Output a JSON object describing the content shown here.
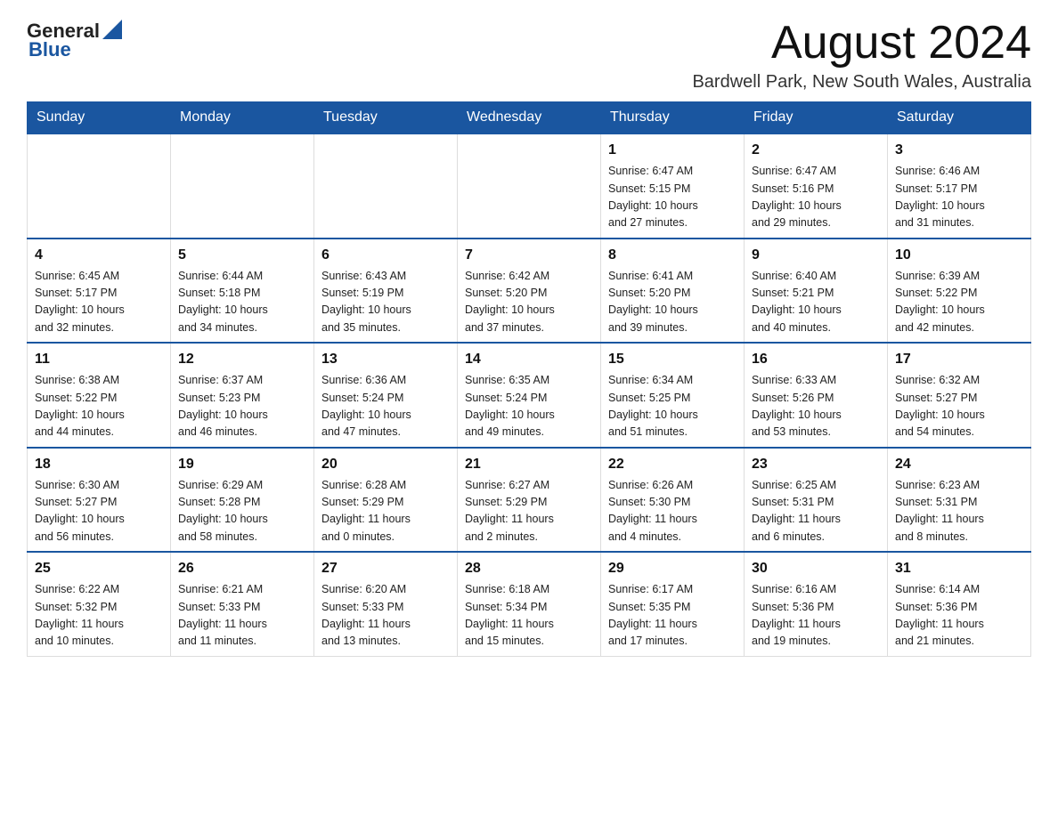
{
  "header": {
    "logo_general": "General",
    "logo_blue": "Blue",
    "month_title": "August 2024",
    "location": "Bardwell Park, New South Wales, Australia"
  },
  "calendar": {
    "days_of_week": [
      "Sunday",
      "Monday",
      "Tuesday",
      "Wednesday",
      "Thursday",
      "Friday",
      "Saturday"
    ],
    "weeks": [
      [
        {
          "day": "",
          "info": ""
        },
        {
          "day": "",
          "info": ""
        },
        {
          "day": "",
          "info": ""
        },
        {
          "day": "",
          "info": ""
        },
        {
          "day": "1",
          "info": "Sunrise: 6:47 AM\nSunset: 5:15 PM\nDaylight: 10 hours\nand 27 minutes."
        },
        {
          "day": "2",
          "info": "Sunrise: 6:47 AM\nSunset: 5:16 PM\nDaylight: 10 hours\nand 29 minutes."
        },
        {
          "day": "3",
          "info": "Sunrise: 6:46 AM\nSunset: 5:17 PM\nDaylight: 10 hours\nand 31 minutes."
        }
      ],
      [
        {
          "day": "4",
          "info": "Sunrise: 6:45 AM\nSunset: 5:17 PM\nDaylight: 10 hours\nand 32 minutes."
        },
        {
          "day": "5",
          "info": "Sunrise: 6:44 AM\nSunset: 5:18 PM\nDaylight: 10 hours\nand 34 minutes."
        },
        {
          "day": "6",
          "info": "Sunrise: 6:43 AM\nSunset: 5:19 PM\nDaylight: 10 hours\nand 35 minutes."
        },
        {
          "day": "7",
          "info": "Sunrise: 6:42 AM\nSunset: 5:20 PM\nDaylight: 10 hours\nand 37 minutes."
        },
        {
          "day": "8",
          "info": "Sunrise: 6:41 AM\nSunset: 5:20 PM\nDaylight: 10 hours\nand 39 minutes."
        },
        {
          "day": "9",
          "info": "Sunrise: 6:40 AM\nSunset: 5:21 PM\nDaylight: 10 hours\nand 40 minutes."
        },
        {
          "day": "10",
          "info": "Sunrise: 6:39 AM\nSunset: 5:22 PM\nDaylight: 10 hours\nand 42 minutes."
        }
      ],
      [
        {
          "day": "11",
          "info": "Sunrise: 6:38 AM\nSunset: 5:22 PM\nDaylight: 10 hours\nand 44 minutes."
        },
        {
          "day": "12",
          "info": "Sunrise: 6:37 AM\nSunset: 5:23 PM\nDaylight: 10 hours\nand 46 minutes."
        },
        {
          "day": "13",
          "info": "Sunrise: 6:36 AM\nSunset: 5:24 PM\nDaylight: 10 hours\nand 47 minutes."
        },
        {
          "day": "14",
          "info": "Sunrise: 6:35 AM\nSunset: 5:24 PM\nDaylight: 10 hours\nand 49 minutes."
        },
        {
          "day": "15",
          "info": "Sunrise: 6:34 AM\nSunset: 5:25 PM\nDaylight: 10 hours\nand 51 minutes."
        },
        {
          "day": "16",
          "info": "Sunrise: 6:33 AM\nSunset: 5:26 PM\nDaylight: 10 hours\nand 53 minutes."
        },
        {
          "day": "17",
          "info": "Sunrise: 6:32 AM\nSunset: 5:27 PM\nDaylight: 10 hours\nand 54 minutes."
        }
      ],
      [
        {
          "day": "18",
          "info": "Sunrise: 6:30 AM\nSunset: 5:27 PM\nDaylight: 10 hours\nand 56 minutes."
        },
        {
          "day": "19",
          "info": "Sunrise: 6:29 AM\nSunset: 5:28 PM\nDaylight: 10 hours\nand 58 minutes."
        },
        {
          "day": "20",
          "info": "Sunrise: 6:28 AM\nSunset: 5:29 PM\nDaylight: 11 hours\nand 0 minutes."
        },
        {
          "day": "21",
          "info": "Sunrise: 6:27 AM\nSunset: 5:29 PM\nDaylight: 11 hours\nand 2 minutes."
        },
        {
          "day": "22",
          "info": "Sunrise: 6:26 AM\nSunset: 5:30 PM\nDaylight: 11 hours\nand 4 minutes."
        },
        {
          "day": "23",
          "info": "Sunrise: 6:25 AM\nSunset: 5:31 PM\nDaylight: 11 hours\nand 6 minutes."
        },
        {
          "day": "24",
          "info": "Sunrise: 6:23 AM\nSunset: 5:31 PM\nDaylight: 11 hours\nand 8 minutes."
        }
      ],
      [
        {
          "day": "25",
          "info": "Sunrise: 6:22 AM\nSunset: 5:32 PM\nDaylight: 11 hours\nand 10 minutes."
        },
        {
          "day": "26",
          "info": "Sunrise: 6:21 AM\nSunset: 5:33 PM\nDaylight: 11 hours\nand 11 minutes."
        },
        {
          "day": "27",
          "info": "Sunrise: 6:20 AM\nSunset: 5:33 PM\nDaylight: 11 hours\nand 13 minutes."
        },
        {
          "day": "28",
          "info": "Sunrise: 6:18 AM\nSunset: 5:34 PM\nDaylight: 11 hours\nand 15 minutes."
        },
        {
          "day": "29",
          "info": "Sunrise: 6:17 AM\nSunset: 5:35 PM\nDaylight: 11 hours\nand 17 minutes."
        },
        {
          "day": "30",
          "info": "Sunrise: 6:16 AM\nSunset: 5:36 PM\nDaylight: 11 hours\nand 19 minutes."
        },
        {
          "day": "31",
          "info": "Sunrise: 6:14 AM\nSunset: 5:36 PM\nDaylight: 11 hours\nand 21 minutes."
        }
      ]
    ]
  }
}
